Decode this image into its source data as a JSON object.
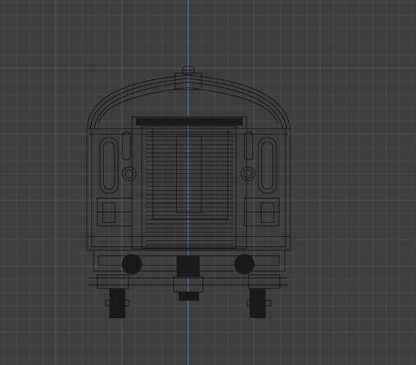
{
  "viewport": {
    "kind": "orthographic-front-view",
    "shading": "wireframe",
    "object_name": "train-car-front"
  },
  "colors": {
    "background": "#3d3d3d",
    "grid_minor": "#474747",
    "grid_major": "#525252",
    "z_axis": "#4a78c8",
    "wire": "#161616",
    "wire_dense": "#0f0f0f"
  }
}
